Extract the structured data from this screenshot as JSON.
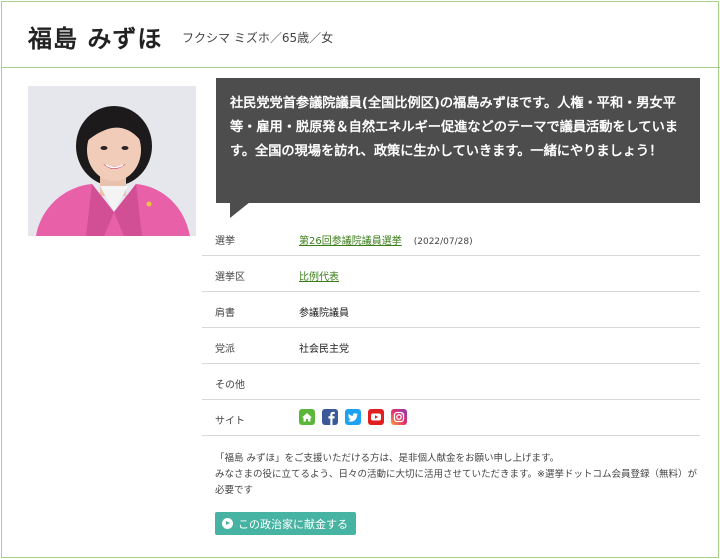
{
  "profile": {
    "name": "福島 みずほ",
    "kana_info": "フクシマ ミズホ／65歳／女",
    "message": "社民党党首参議院議員(全国比例区)の福島みずほです。人権・平和・男女平等・雇用・脱原発＆自然エネルギー促進などのテーマで議員活動をしています。全国の現場を訪れ、政策に生かしていきます。一緒にやりましょう！"
  },
  "rows": {
    "election": {
      "label": "選挙",
      "value": "第26回参議院議員選挙",
      "date": "(2022/07/28)"
    },
    "district": {
      "label": "選挙区",
      "value": "比例代表"
    },
    "title": {
      "label": "肩書",
      "value": "参議院議員"
    },
    "party": {
      "label": "党派",
      "value": "社会民主党"
    },
    "other": {
      "label": "その他",
      "value": ""
    },
    "site": {
      "label": "サイト"
    }
  },
  "sns_icons": [
    "home-icon",
    "facebook-icon",
    "twitter-icon",
    "youtube-icon",
    "instagram-icon"
  ],
  "note": {
    "line1": "「福島 みずほ」をご支援いただける方は、是非個人献金をお願い申し上げます。",
    "line2": "みなさまの役に立てるよう、日々の活動に大切に活用させていただきます。※選挙ドットコム会員登録（無料）が必要です"
  },
  "donate_label": "この政治家に献金する",
  "colors": {
    "border": "#a8d08d",
    "link": "#3a7d19",
    "bubble": "#4d4d4d",
    "donate": "#47b3a2"
  }
}
